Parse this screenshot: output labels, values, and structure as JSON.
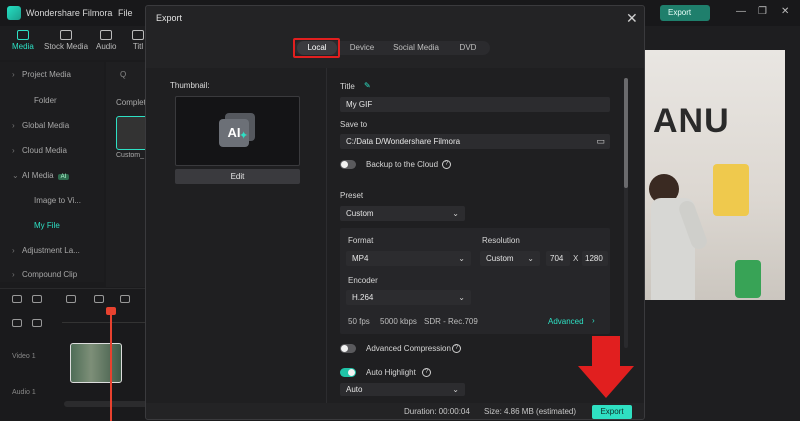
{
  "app": {
    "name": "Wondershare Filmora",
    "menu_file": "File",
    "export_label": "Export",
    "window_controls": [
      "—",
      "❐",
      "✕"
    ]
  },
  "toolbar": [
    {
      "label": "Media",
      "icon": "media-icon",
      "active": true
    },
    {
      "label": "Stock Media",
      "icon": "stock-media-icon",
      "active": false
    },
    {
      "label": "Audio",
      "icon": "audio-icon",
      "active": false
    },
    {
      "label": "Titl",
      "icon": "titles-icon",
      "active": false
    }
  ],
  "sidebar": {
    "items": [
      {
        "label": "Project Media",
        "chevron": "›"
      },
      {
        "label": "Folder"
      },
      {
        "label": "Global Media",
        "chevron": "›"
      },
      {
        "label": "Cloud Media",
        "chevron": "›"
      },
      {
        "label": "AI Media",
        "chevron": "⌄",
        "badge": "AI"
      },
      {
        "label": "Image to Vi..."
      },
      {
        "label": "My File"
      },
      {
        "label": "Adjustment La...",
        "chevron": "›"
      },
      {
        "label": "Compound Clip",
        "chevron": "›"
      }
    ]
  },
  "media": {
    "search_glyph": "Q",
    "section": "Complet",
    "item_label": "Custom_"
  },
  "timeline": {
    "tracks": [
      "Video 1",
      "Audio 1"
    ]
  },
  "dialog": {
    "title": "Export",
    "close_glyph": "✕",
    "tabs": [
      {
        "label": "Local",
        "active": true
      },
      {
        "label": "Device",
        "active": false
      },
      {
        "label": "Social Media",
        "active": false
      },
      {
        "label": "DVD",
        "active": false
      }
    ],
    "thumbnail_label": "Thumbnail:",
    "thumbnail_glyph": "AI",
    "edit_label": "Edit",
    "title_label": "Title",
    "title_value": "My GIF",
    "save_to_label": "Save to",
    "save_to_value": "C:/Data D/Wondershare Filmora",
    "backup_label": "Backup to the Cloud",
    "backup_on": false,
    "preset_label": "Preset",
    "preset_value": "Custom",
    "format_label": "Format",
    "format_value": "MP4",
    "resolution_label": "Resolution",
    "resolution_value": "Custom",
    "res_width": "704",
    "res_x": "X",
    "res_height": "1280",
    "encoder_label": "Encoder",
    "encoder_value": "H.264",
    "fps": "50 fps",
    "bitrate": "5000 kbps",
    "color": "SDR - Rec.709",
    "advanced_label": "Advanced",
    "advanced_chevron": "›",
    "advanced_compression_label": "Advanced Compression",
    "advanced_compression_on": false,
    "auto_highlight_label": "Auto Highlight",
    "auto_highlight_on": true,
    "auto_highlight_value": "Auto",
    "duration": "Duration: 00:00:04",
    "size": "Size:  4.86 MB (estimated)",
    "export_label": "Export"
  },
  "preview": {
    "letters": "ANU"
  },
  "colors": {
    "accent": "#2fe0c2",
    "annotation_red": "#e11f1f"
  }
}
